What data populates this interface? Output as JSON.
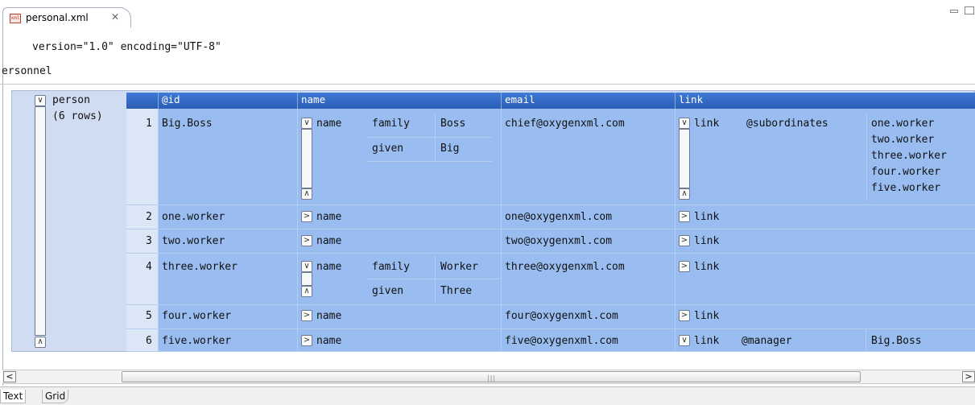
{
  "editor": {
    "tab_label": "personal.xml",
    "file_icon_text": "xml",
    "close_glyph": "✕",
    "xml_declaration": "version=\"1.0\" encoding=\"UTF-8\"",
    "root_element": "ersonnel"
  },
  "grid": {
    "group_label": "person",
    "group_count": "(6 rows)",
    "headers": {
      "id": "@id",
      "name": "name",
      "email": "email",
      "link": "link"
    },
    "rows": [
      {
        "num": "1",
        "id": "Big.Boss",
        "name_label": "name",
        "family": "family",
        "family_val": "Boss",
        "given": "given",
        "given_val": "Big",
        "email": "chief@oxygenxml.com",
        "link_label": "link",
        "link_attr": "@subordinates",
        "link_vals": [
          "one.worker",
          "two.worker",
          "three.worker",
          "four.worker",
          "five.worker"
        ]
      },
      {
        "num": "2",
        "id": "one.worker",
        "name_label": "name",
        "email": "one@oxygenxml.com",
        "link_label": "link"
      },
      {
        "num": "3",
        "id": "two.worker",
        "name_label": "name",
        "email": "two@oxygenxml.com",
        "link_label": "link"
      },
      {
        "num": "4",
        "id": "three.worker",
        "name_label": "name",
        "family": "family",
        "family_val": "Worker",
        "given": "given",
        "given_val": "Three",
        "email": "three@oxygenxml.com",
        "link_label": "link"
      },
      {
        "num": "5",
        "id": "four.worker",
        "name_label": "name",
        "email": "four@oxygenxml.com",
        "link_label": "link"
      },
      {
        "num": "6",
        "id": "five.worker",
        "name_label": "name",
        "email": "five@oxygenxml.com",
        "link_label": "link",
        "link_attr": "@manager",
        "link_val": "Big.Boss"
      }
    ]
  },
  "scroll": {
    "left_arrow": "<",
    "right_arrow": ">",
    "grip": "|||"
  },
  "modes": {
    "text": "Text",
    "grid": "Grid"
  },
  "colors": {
    "header_blue": "#2f67c6",
    "cell_blue": "#99bdf0"
  }
}
